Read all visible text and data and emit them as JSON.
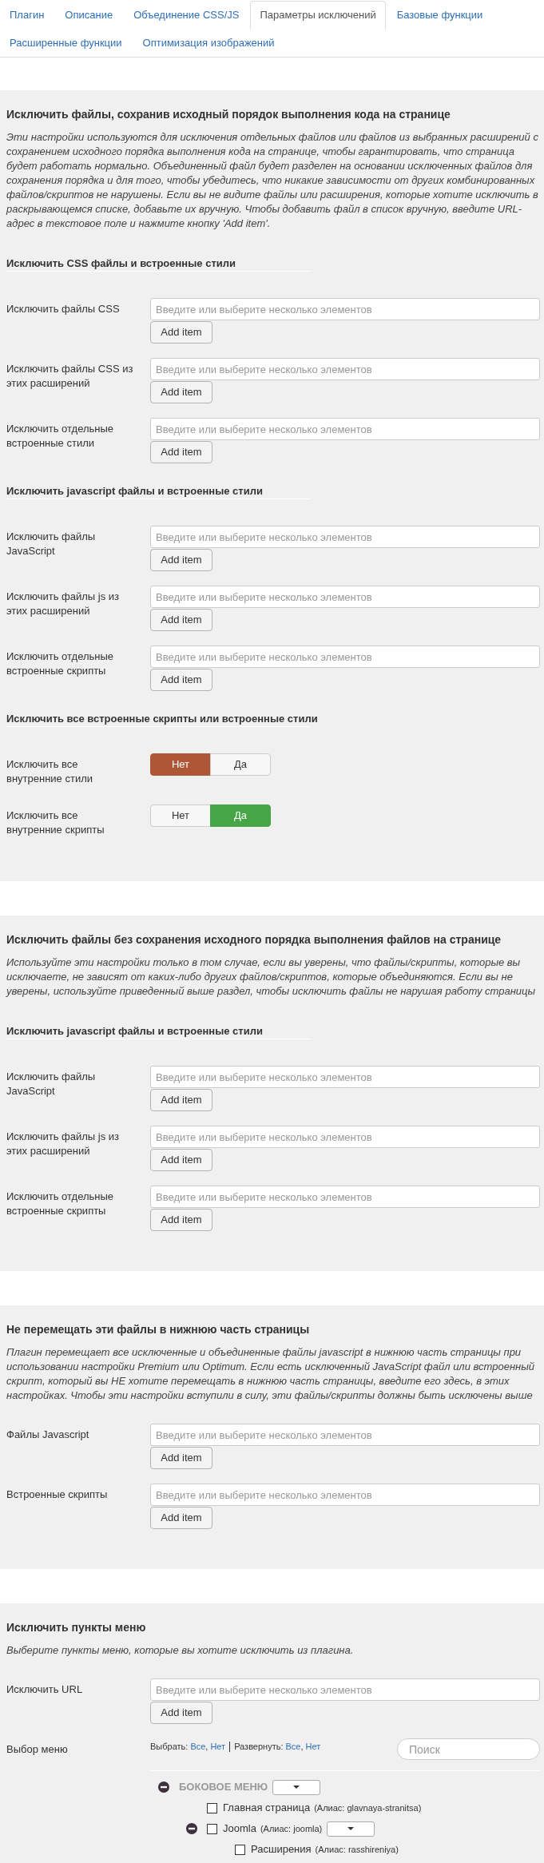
{
  "tabs": [
    {
      "label": "Плагин",
      "selected": false
    },
    {
      "label": "Описание",
      "selected": false
    },
    {
      "label": "Объединение CSS/JS",
      "selected": false
    },
    {
      "label": "Параметры исключений",
      "selected": true
    },
    {
      "label": "Базовые функции",
      "selected": false
    },
    {
      "label": "Расширенные функции",
      "selected": false
    },
    {
      "label": "Оптимизация изображений",
      "selected": false
    }
  ],
  "sections": [
    {
      "title": "Исключить файлы, сохранив исходный порядок выполнения кода на странице",
      "description": "Эти настройки используются для исключения отдельных файлов или файлов из выбранных расширений с сохранением исходного порядка выполнения кода на странице, чтобы гарантировать, что страница будет работать нормально. Объединенный файл будет разделен на основании исключенных файлов для сохранения порядка и для того, чтобы убедитесь, что никакие зависимости от других комбинированных файлов/скриптов не нарушены. Если вы не видите файлы или расширения, которые хотите исключить в раскрывающемся списке, добавьте их вручную. Чтобы добавить файл в список вручную, введите URL-адрес в текстовое поле и нажмите кнопку 'Add item'.",
      "groups": [
        {
          "subtitle": "Исключить CSS файлы и встроенные стили",
          "fields": [
            {
              "kind": "list",
              "label": "Исключить файлы CSS",
              "placeholder": "Введите или выберите несколько элементов",
              "button": "Add item"
            },
            {
              "kind": "list",
              "label": "Исключить файлы CSS из этих расширений",
              "placeholder": "Введите или выберите несколько элементов",
              "button": "Add item"
            },
            {
              "kind": "list",
              "label": "Исключить отдельные встроенные стили",
              "placeholder": "Введите или выберите несколько элементов",
              "button": "Add item"
            }
          ]
        },
        {
          "subtitle": "Исключить javascript файлы и встроенные стили",
          "fields": [
            {
              "kind": "list",
              "label": "Исключить файлы JavaScript",
              "placeholder": "Введите или выберите несколько элементов",
              "button": "Add item"
            },
            {
              "kind": "list",
              "label": "Исключить файлы js из этих расширений",
              "placeholder": "Введите или выберите несколько элементов",
              "button": "Add item"
            },
            {
              "kind": "list",
              "label": "Исключить отдельные встроенные скрипты",
              "placeholder": "Введите или выберите несколько элементов",
              "button": "Add item"
            }
          ]
        },
        {
          "subtitle": "Исключить все встроенные скрипты или встроенные стили",
          "fields": [
            {
              "kind": "toggle",
              "label": "Исключить все внутренние стили",
              "options": [
                {
                  "label": "Нет",
                  "kind": "no",
                  "selected": true
                },
                {
                  "label": "Да",
                  "kind": "yes",
                  "selected": false
                }
              ]
            },
            {
              "kind": "toggle",
              "label": "Исключить все внутренние скрипты",
              "options": [
                {
                  "label": "Нет",
                  "kind": "no",
                  "selected": false
                },
                {
                  "label": "Да",
                  "kind": "yes",
                  "selected": true
                }
              ]
            }
          ]
        }
      ]
    },
    {
      "title": "Исключить файлы без сохранения исходного порядка выполнения файлов на странице",
      "description": "Используйте эти настройки только в том случае, если вы уверены, что файлы/скрипты, которые вы исключаете, не зависят от каких-либо других файлов/скриптов, которые объединяются. Если вы не уверены, используйте приведенный выше раздел, чтобы исключить файлы не нарушая работу страницы",
      "groups": [
        {
          "subtitle": "Исключить javascript файлы и встроенные стили",
          "fields": [
            {
              "kind": "list",
              "label": "Исключить файлы JavaScript",
              "placeholder": "Введите или выберите несколько элементов",
              "button": "Add item"
            },
            {
              "kind": "list",
              "label": "Исключить файлы js из этих расширений",
              "placeholder": "Введите или выберите несколько элементов",
              "button": "Add item"
            },
            {
              "kind": "list",
              "label": "Исключить отдельные встроенные скрипты",
              "placeholder": "Введите или выберите несколько элементов",
              "button": "Add item"
            }
          ]
        }
      ]
    },
    {
      "title": "Не перемещать эти файлы в нижнюю часть страницы",
      "description": "Плагин перемещает все исключенные и объединенные файлы javascript в нижнюю часть страницы при использовании настройки Premium или Optimum. Если есть исключенный JavaScript файл или встроенный скрипт, который вы НЕ хотите перемещать в нижнюю часть страницы, введите его здесь, в этих настройках. Чтобы эти настройки вступили в силу, эти файлы/скрипты должны быть исключены выше",
      "groups": [
        {
          "fields": [
            {
              "kind": "list",
              "label": "Файлы Javascript",
              "placeholder": "Введите или выберите несколько элементов",
              "button": "Add item"
            },
            {
              "kind": "list",
              "label": "Встроенные скрипты",
              "placeholder": "Введите или выберите несколько элементов",
              "button": "Add item"
            }
          ]
        }
      ]
    },
    {
      "title": "Исключить пункты меню",
      "description": "Выберите пункты меню, которые вы хотите исключить из плагина.",
      "groups": [
        {
          "fields": [
            {
              "kind": "list",
              "label": "Исключить URL",
              "placeholder": "Введите или выберите несколько элементов",
              "button": "Add item"
            },
            {
              "kind": "menu_tree",
              "label": "Выбор меню",
              "tree_actions": [
                {
                  "label": "Выбрать:",
                  "links": [
                    "Все",
                    "Нет"
                  ]
                },
                {
                  "label": "Развернуть:",
                  "links": [
                    "Все",
                    "Нет"
                  ]
                }
              ],
              "link_separator": ",",
              "search": {
                "placeholder": "Поиск"
              },
              "menus": [
                {
                  "title": "БОКОВОЕ МЕНЮ",
                  "expanded": true,
                  "children": [
                    {
                      "title": "Главная страница",
                      "alias_note": "(Алиас: glavnaya-stranitsa)",
                      "checked": false
                    },
                    {
                      "title": "Joomla",
                      "alias_note": "(Алиас: joomla)",
                      "checked": false,
                      "expanded": true,
                      "children": [
                        {
                          "title": "Расширения",
                          "alias_note": "(Алиас: rasshireniya)",
                          "checked": false
                        }
                      ]
                    }
                  ]
                }
              ]
            }
          ]
        }
      ]
    }
  ]
}
